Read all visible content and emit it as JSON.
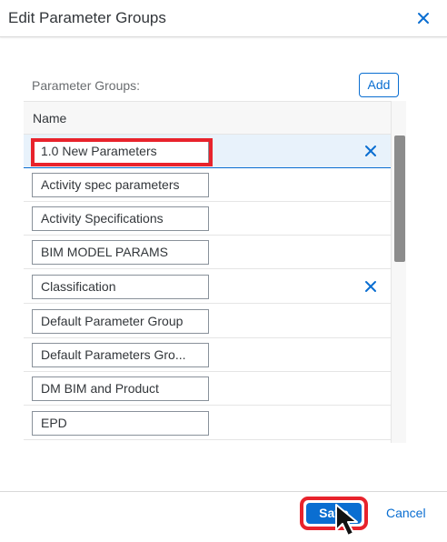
{
  "dialog": {
    "title": "Edit Parameter Groups",
    "close_icon": "close-icon"
  },
  "section": {
    "label": "Parameter Groups:",
    "add_label": "Add"
  },
  "table": {
    "column_name": "Name",
    "rows": [
      {
        "value": "1.0 New Parameters",
        "selected": true,
        "delete_icon": "x-icon"
      },
      {
        "value": "Activity spec parameters"
      },
      {
        "value": "Activity Specifications"
      },
      {
        "value": "BIM MODEL PARAMS"
      },
      {
        "value": "Classification",
        "delete_icon": "x-icon"
      },
      {
        "value": "Default Parameter Group"
      },
      {
        "value": "Default Parameters Gro..."
      },
      {
        "value": "DM BIM and Product"
      },
      {
        "value": "EPD"
      }
    ]
  },
  "footer": {
    "save_label": "Save",
    "cancel_label": "Cancel"
  },
  "colors": {
    "accent": "#0a6ed1",
    "highlight": "#e8232c",
    "selected_row": "#e8f2fb"
  }
}
